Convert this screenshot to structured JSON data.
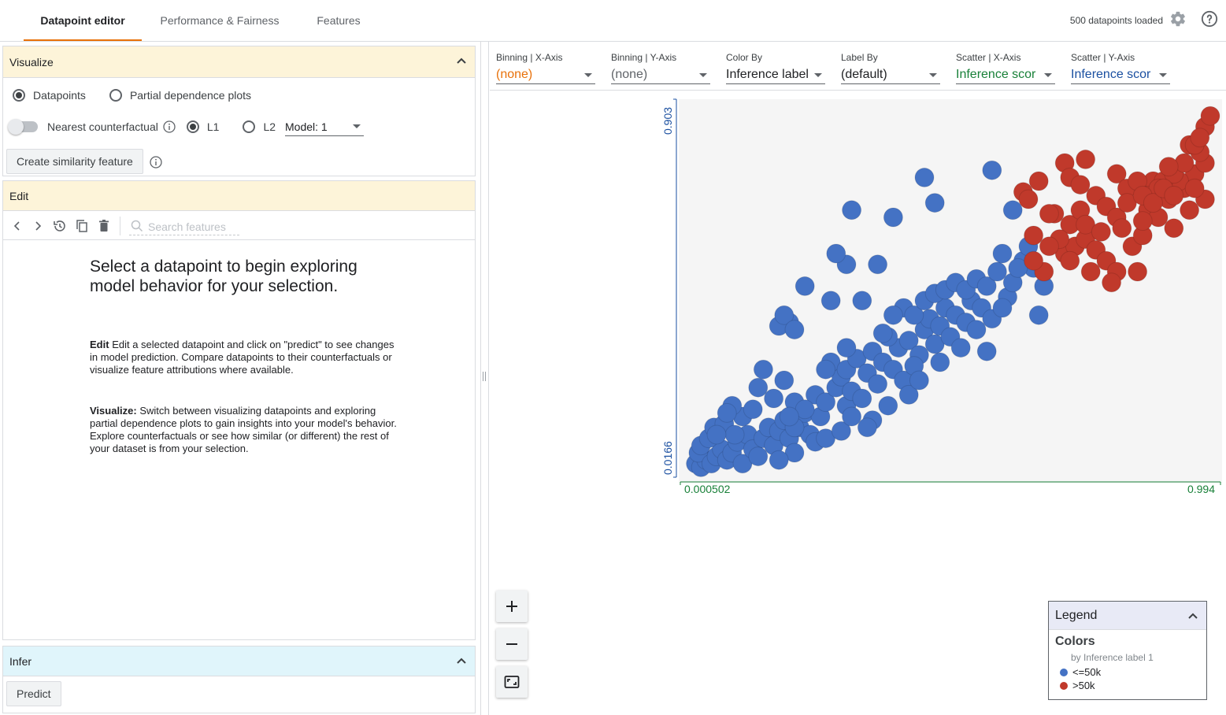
{
  "tabs": [
    {
      "label": "Datapoint editor",
      "active": true
    },
    {
      "label": "Performance & Fairness",
      "active": false
    },
    {
      "label": "Features",
      "active": false
    }
  ],
  "header": {
    "datapoints_loaded": "500 datapoints loaded",
    "icons": [
      "gear-icon",
      "help-icon"
    ]
  },
  "visualize": {
    "title": "Visualize",
    "options": [
      "Datapoints",
      "Partial dependence plots"
    ],
    "selected": "Datapoints",
    "counterfactual_label": "Nearest counterfactual",
    "distance_options": [
      "L1",
      "L2"
    ],
    "distance_selected": "L1",
    "model_select": "Model: 1",
    "similarity_button": "Create similarity feature"
  },
  "edit": {
    "title": "Edit",
    "search_placeholder": "Search features",
    "intro_title": "Select a datapoint to begin exploring model behavior for your selection.",
    "edit_heading": "Edit",
    "edit_text": "Edit a selected datapoint and click on \"predict\" to see changes in model prediction. Compare datapoints to their counterfactuals or visualize feature attributions where available.",
    "visualize_heading": "Visualize:",
    "visualize_text": "Switch between visualizing datapoints and exploring partial dependence plots to gain insights into your model's behavior. Explore counterfactuals or see how similar (or different) the rest of your dataset is from your selection."
  },
  "infer": {
    "title": "Infer",
    "predict_button": "Predict"
  },
  "controls": [
    {
      "label": "Binning | X-Axis",
      "value": "(none)",
      "color": "#e8710a"
    },
    {
      "label": "Binning | Y-Axis",
      "value": "(none)",
      "color": "#5f6368"
    },
    {
      "label": "Color By",
      "value": "Inference label",
      "color": "#202124"
    },
    {
      "label": "Label By",
      "value": "(default)",
      "color": "#202124"
    },
    {
      "label": "Scatter | X-Axis",
      "value": "Inference scor",
      "color": "#188038"
    },
    {
      "label": "Scatter | Y-Axis",
      "value": "Inference scor",
      "color": "#1a4fa0"
    }
  ],
  "legend": {
    "title": "Legend",
    "colors_title": "Colors",
    "subtitle": "by Inference label 1",
    "items": [
      {
        "label": "<=50k",
        "color": "#4472c4"
      },
      {
        "label": ">50k",
        "color": "#c0392b"
      }
    ]
  },
  "chart_data": {
    "type": "scatter",
    "x_axis": {
      "min_label": "0.000502",
      "max_label": "0.994",
      "color": "#188038"
    },
    "y_axis": {
      "min_label": "0.0166",
      "max_label": "0.903",
      "color": "#1a4fa0"
    },
    "series": [
      {
        "name": "<=50k",
        "color": "#4472c4",
        "points": [
          [
            0.01,
            0.02
          ],
          [
            0.02,
            0.01
          ],
          [
            0.03,
            0.03
          ],
          [
            0.015,
            0.05
          ],
          [
            0.04,
            0.02
          ],
          [
            0.05,
            0.04
          ],
          [
            0.06,
            0.06
          ],
          [
            0.02,
            0.07
          ],
          [
            0.035,
            0.09
          ],
          [
            0.07,
            0.03
          ],
          [
            0.08,
            0.05
          ],
          [
            0.09,
            0.08
          ],
          [
            0.1,
            0.02
          ],
          [
            0.11,
            0.1
          ],
          [
            0.12,
            0.06
          ],
          [
            0.045,
            0.12
          ],
          [
            0.065,
            0.13
          ],
          [
            0.085,
            0.1
          ],
          [
            0.13,
            0.04
          ],
          [
            0.14,
            0.09
          ],
          [
            0.15,
            0.12
          ],
          [
            0.16,
            0.07
          ],
          [
            0.17,
            0.11
          ],
          [
            0.18,
            0.14
          ],
          [
            0.19,
            0.09
          ],
          [
            0.2,
            0.05
          ],
          [
            0.21,
            0.12
          ],
          [
            0.22,
            0.16
          ],
          [
            0.23,
            0.1
          ],
          [
            0.25,
            0.15
          ],
          [
            0.1,
            0.15
          ],
          [
            0.12,
            0.17
          ],
          [
            0.2,
            0.19
          ],
          [
            0.24,
            0.21
          ],
          [
            0.26,
            0.19
          ],
          [
            0.28,
            0.23
          ],
          [
            0.3,
            0.18
          ],
          [
            0.29,
            0.26
          ],
          [
            0.31,
            0.22
          ],
          [
            0.33,
            0.2
          ],
          [
            0.27,
            0.3
          ],
          [
            0.3,
            0.28
          ],
          [
            0.32,
            0.31
          ],
          [
            0.34,
            0.27
          ],
          [
            0.36,
            0.24
          ],
          [
            0.35,
            0.33
          ],
          [
            0.37,
            0.3
          ],
          [
            0.39,
            0.28
          ],
          [
            0.41,
            0.25
          ],
          [
            0.4,
            0.34
          ],
          [
            0.38,
            0.37
          ],
          [
            0.42,
            0.36
          ],
          [
            0.44,
            0.32
          ],
          [
            0.43,
            0.29
          ],
          [
            0.45,
            0.39
          ],
          [
            0.47,
            0.35
          ],
          [
            0.46,
            0.42
          ],
          [
            0.48,
            0.4
          ],
          [
            0.5,
            0.37
          ],
          [
            0.52,
            0.34
          ],
          [
            0.49,
            0.45
          ],
          [
            0.51,
            0.43
          ],
          [
            0.53,
            0.41
          ],
          [
            0.55,
            0.39
          ],
          [
            0.54,
            0.47
          ],
          [
            0.56,
            0.45
          ],
          [
            0.58,
            0.42
          ],
          [
            0.41,
            0.45
          ],
          [
            0.43,
            0.43
          ],
          [
            0.45,
            0.47
          ],
          [
            0.47,
            0.49
          ],
          [
            0.49,
            0.5
          ],
          [
            0.51,
            0.52
          ],
          [
            0.53,
            0.5
          ],
          [
            0.55,
            0.53
          ],
          [
            0.57,
            0.51
          ],
          [
            0.59,
            0.55
          ],
          [
            0.61,
            0.48
          ],
          [
            0.6,
            0.45
          ],
          [
            0.62,
            0.52
          ],
          [
            0.64,
            0.58
          ],
          [
            0.66,
            0.56
          ],
          [
            0.68,
            0.51
          ],
          [
            0.67,
            0.43
          ],
          [
            0.22,
            0.17
          ],
          [
            0.26,
            0.28
          ],
          [
            0.18,
            0.25
          ],
          [
            0.35,
            0.14
          ],
          [
            0.38,
            0.18
          ],
          [
            0.42,
            0.21
          ],
          [
            0.44,
            0.25
          ],
          [
            0.48,
            0.3
          ],
          [
            0.57,
            0.33
          ],
          [
            0.3,
            0.34
          ],
          [
            0.37,
            0.38
          ],
          [
            0.33,
            0.47
          ],
          [
            0.13,
            0.23
          ],
          [
            0.16,
            0.2
          ],
          [
            0.08,
            0.18
          ],
          [
            0.14,
            0.28
          ],
          [
            0.2,
            0.12
          ],
          [
            0.24,
            0.08
          ],
          [
            0.05,
            0.1
          ],
          [
            0.07,
            0.16
          ],
          [
            0.17,
            0.03
          ],
          [
            0.19,
            0.15
          ],
          [
            0.26,
            0.09
          ],
          [
            0.34,
            0.12
          ],
          [
            0.29,
            0.11
          ],
          [
            0.31,
            0.15
          ],
          [
            0.19,
            0.41
          ],
          [
            0.17,
            0.4
          ],
          [
            0.18,
            0.43
          ],
          [
            0.2,
            0.39
          ],
          [
            0.22,
            0.51
          ],
          [
            0.39,
            0.43
          ],
          [
            0.27,
            0.47
          ],
          [
            0.3,
            0.57
          ],
          [
            0.28,
            0.6
          ],
          [
            0.36,
            0.57
          ],
          [
            0.39,
            0.7
          ],
          [
            0.31,
            0.72
          ],
          [
            0.45,
            0.81
          ],
          [
            0.47,
            0.74
          ],
          [
            0.58,
            0.83
          ],
          [
            0.62,
            0.72
          ],
          [
            0.65,
            0.62
          ],
          [
            0.63,
            0.56
          ],
          [
            0.6,
            0.6
          ]
        ]
      },
      {
        "name": ">50k",
        "color": "#c0392b",
        "points": [
          [
            0.64,
            0.77
          ],
          [
            0.67,
            0.8
          ],
          [
            0.65,
            0.75
          ],
          [
            0.7,
            0.71
          ],
          [
            0.73,
            0.68
          ],
          [
            0.75,
            0.72
          ],
          [
            0.78,
            0.76
          ],
          [
            0.8,
            0.73
          ],
          [
            0.82,
            0.7
          ],
          [
            0.72,
            0.6
          ],
          [
            0.74,
            0.62
          ],
          [
            0.76,
            0.64
          ],
          [
            0.78,
            0.61
          ],
          [
            0.8,
            0.58
          ],
          [
            0.82,
            0.55
          ],
          [
            0.85,
            0.62
          ],
          [
            0.87,
            0.65
          ],
          [
            0.86,
            0.55
          ],
          [
            0.88,
            0.72
          ],
          [
            0.9,
            0.7
          ],
          [
            0.92,
            0.75
          ],
          [
            0.95,
            0.78
          ],
          [
            0.97,
            0.82
          ],
          [
            0.99,
            0.85
          ],
          [
            0.98,
            0.88
          ],
          [
            0.96,
            0.9
          ],
          [
            0.94,
            0.8
          ],
          [
            0.89,
            0.8
          ],
          [
            0.91,
            0.8
          ],
          [
            0.93,
            0.82
          ],
          [
            0.95,
            0.85
          ],
          [
            0.97,
            0.9
          ],
          [
            0.99,
            0.95
          ],
          [
            1.0,
            0.98
          ],
          [
            0.98,
            0.92
          ],
          [
            0.82,
            0.82
          ],
          [
            0.84,
            0.78
          ],
          [
            0.86,
            0.8
          ],
          [
            0.88,
            0.76
          ],
          [
            0.9,
            0.78
          ],
          [
            0.76,
            0.68
          ],
          [
            0.79,
            0.66
          ],
          [
            0.71,
            0.64
          ],
          [
            0.73,
            0.58
          ],
          [
            0.77,
            0.55
          ],
          [
            0.69,
            0.62
          ],
          [
            0.66,
            0.65
          ],
          [
            0.68,
            0.55
          ],
          [
            0.81,
            0.52
          ],
          [
            0.83,
            0.67
          ],
          [
            0.84,
            0.74
          ],
          [
            0.87,
            0.76
          ],
          [
            0.89,
            0.74
          ],
          [
            0.91,
            0.78
          ],
          [
            0.93,
            0.76
          ],
          [
            0.92,
            0.84
          ],
          [
            0.96,
            0.72
          ],
          [
            0.99,
            0.75
          ],
          [
            0.97,
            0.78
          ],
          [
            0.76,
            0.86
          ],
          [
            0.72,
            0.85
          ],
          [
            0.73,
            0.81
          ],
          [
            0.66,
            0.58
          ],
          [
            0.69,
            0.71
          ],
          [
            0.75,
            0.79
          ],
          [
            0.87,
            0.69
          ],
          [
            0.93,
            0.67
          ]
        ]
      }
    ]
  }
}
